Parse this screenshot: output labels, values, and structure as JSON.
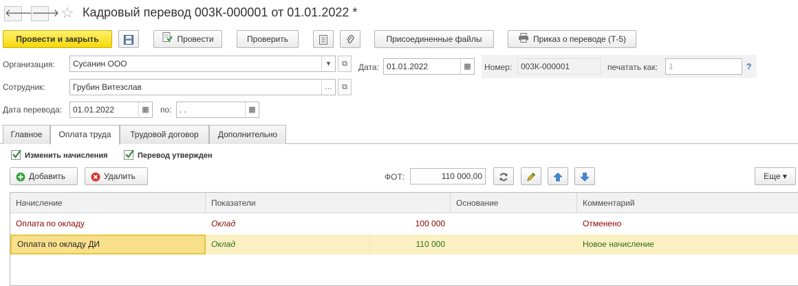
{
  "header": {
    "title": "Кадровый перевод 003К-000001 от 01.01.2022 *",
    "back_glyph": "🡐",
    "forward_glyph": "🡒"
  },
  "toolbar": {
    "post_close": "Провести и закрыть",
    "post": "Провести",
    "check": "Проверить",
    "attached_files": "Присоединенные файлы",
    "order": "Приказ о переводе (Т-5)"
  },
  "form": {
    "org_label": "Организация:",
    "org_value": "Сусанин ООО",
    "date_label": "Дата:",
    "date_value": "01.01.2022",
    "number_label": "Номер:",
    "number_value": "003К-000001",
    "print_as_label": "печатать как:",
    "print_as_value": "1",
    "help": "?",
    "employee_label": "Сотрудник:",
    "employee_value": "Грубин Витезслав",
    "transfer_date_label": "Дата перевода:",
    "transfer_date_value": "01.01.2022",
    "to_label": "по:",
    "to_value": " .  ."
  },
  "tabs": [
    {
      "label": "Главное"
    },
    {
      "label": "Оплата труда"
    },
    {
      "label": "Трудовой договор"
    },
    {
      "label": "Дополнительно"
    }
  ],
  "payroll": {
    "change_accruals": "Изменить начисления",
    "approved": "Перевод утвержден",
    "add": "Добавить",
    "delete": "Удалить",
    "fot_label": "ФОТ:",
    "fot_value": "110 000,00",
    "more": "Еще"
  },
  "table": {
    "columns": [
      "Начисление",
      "Показатели",
      "Основание",
      "Комментарий"
    ],
    "rows": [
      {
        "accrual": "Оплата по окладу",
        "indicator": "Оклад",
        "amount": "100 000",
        "basis": "",
        "comment": "Отменено"
      },
      {
        "accrual": "Оплата по окладу ДИ",
        "indicator": "Оклад",
        "amount": "110 000",
        "basis": "",
        "comment": "Новое начисление"
      }
    ]
  },
  "colors": {
    "primary_button": "#f6d90a",
    "cancelled_text": "#8b0000",
    "new_text": "#2e6b1e",
    "selected_row": "#fbf0c2"
  }
}
